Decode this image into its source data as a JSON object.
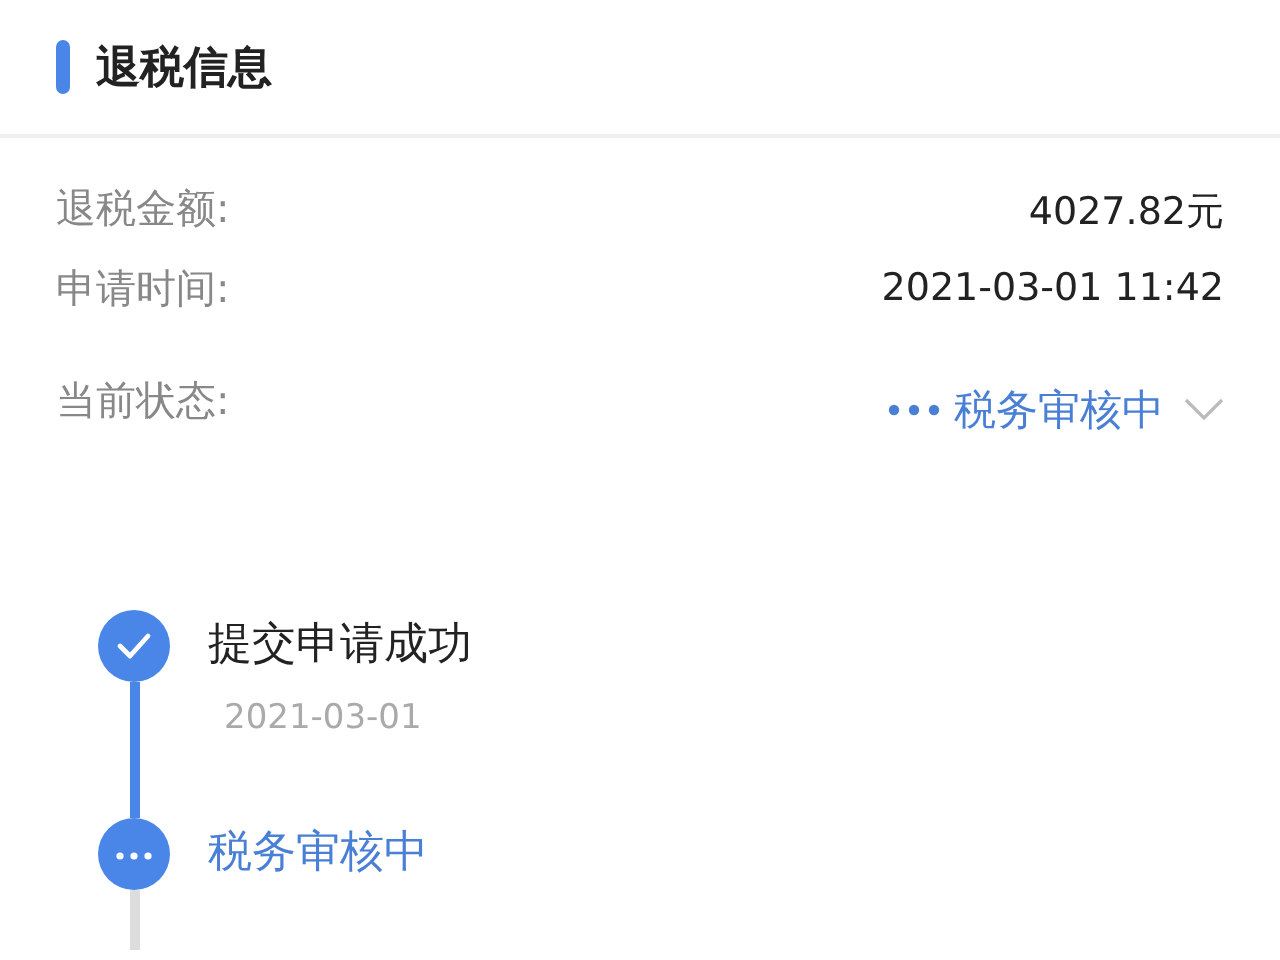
{
  "section": {
    "title": "退税信息"
  },
  "fields": [
    {
      "label": "退税金额:",
      "value": "4027.82元",
      "kind": "text"
    },
    {
      "label": "申请时间:",
      "value": "2021-03-01 11:42",
      "kind": "text"
    },
    {
      "label": "当前状态:",
      "value": "税务审核中",
      "kind": "status",
      "expanded": false
    }
  ],
  "timeline": [
    {
      "title": "提交申请成功",
      "date": "2021-03-01",
      "kind": "done"
    },
    {
      "title": "税务审核中",
      "kind": "pending"
    }
  ]
}
